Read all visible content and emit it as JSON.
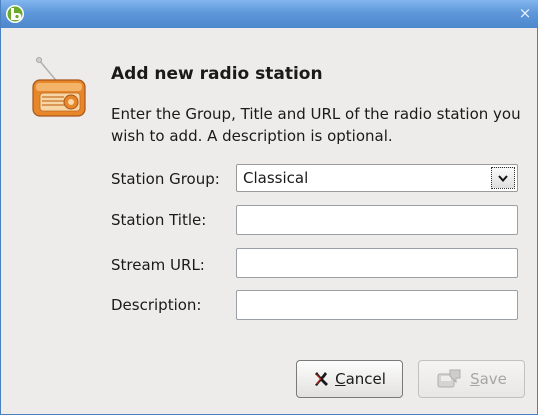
{
  "window": {
    "title": "",
    "close_glyph": "×"
  },
  "heading": "Add new radio station",
  "description": "Enter the Group, Title and URL of the radio station you wish to add. A description is optional.",
  "fields": {
    "group": {
      "label": "Station Group:",
      "value": "Classical"
    },
    "title": {
      "label": "Station Title:",
      "value": ""
    },
    "url": {
      "label": "Stream URL:",
      "value": ""
    },
    "description": {
      "label": "Description:",
      "value": ""
    }
  },
  "buttons": {
    "cancel": {
      "mnemonic": "C",
      "rest": "ancel",
      "enabled": true
    },
    "save": {
      "mnemonic": "S",
      "rest": "ave",
      "enabled": false
    }
  },
  "icons": {
    "app": "app-logo-icon",
    "radio": "radio-icon",
    "cancel": "cancel-x-icon",
    "save": "save-icon",
    "dropdown": "chevron-down-icon",
    "close": "close-icon"
  },
  "colors": {
    "titlebar": "#5f98da",
    "dialog_bg": "#edeceb",
    "radio_orange": "#e8862a",
    "cancel_icon": "#c0281c"
  }
}
